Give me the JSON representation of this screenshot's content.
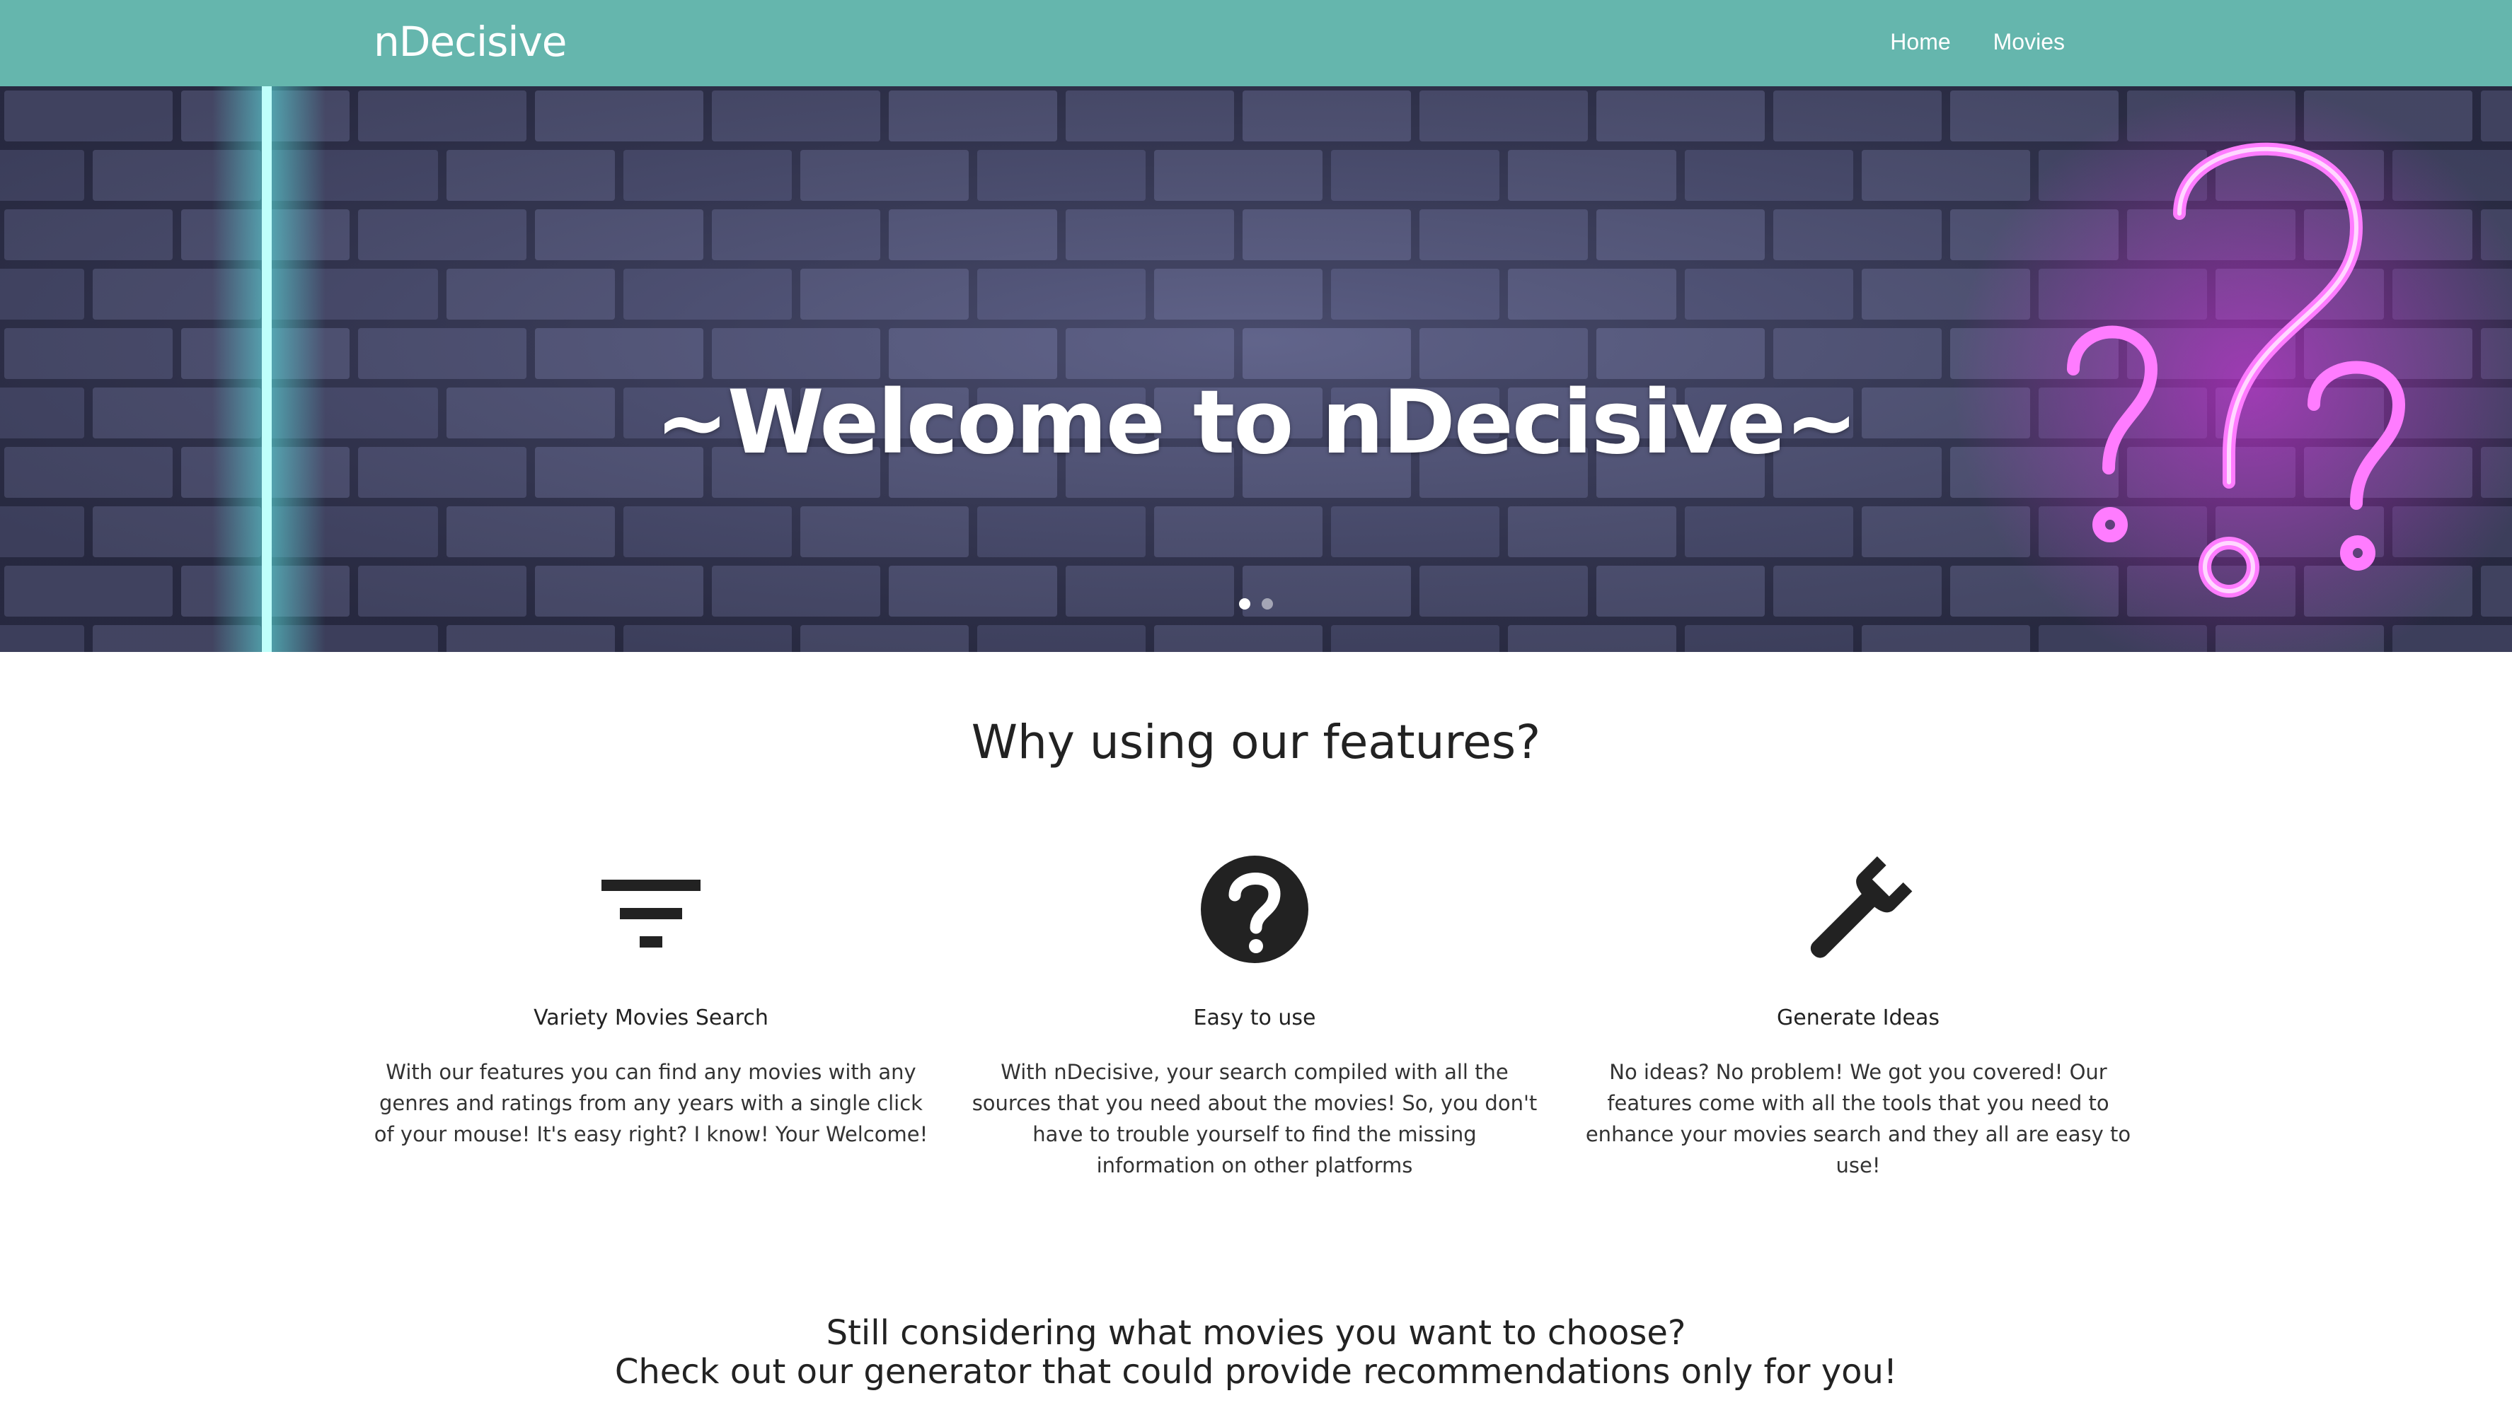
{
  "navbar": {
    "brand": "nDecisive",
    "links": [
      {
        "label": "Home"
      },
      {
        "label": "Movies"
      }
    ],
    "background": "#65b6ad"
  },
  "hero": {
    "title": "~Welcome to nDecisive~",
    "slides": 2,
    "active_slide": 1,
    "colors": {
      "wall": "#4b4d6e",
      "neon_left": "#5ff3ee",
      "neon_right": "#e62ef0"
    }
  },
  "features": {
    "heading": "Why using our features?",
    "items": [
      {
        "icon": "filter-icon",
        "title": "Variety Movies Search",
        "description": "With our features you can find any movies with any genres and ratings from any years with a single click of your mouse! It's easy right? I know! Your Welcome!"
      },
      {
        "icon": "question-circle-icon",
        "title": "Easy to use",
        "description": "With nDecisive, your search compiled with all the sources that you need about the movies! So, you don't have to trouble yourself to find the missing information on other platforms"
      },
      {
        "icon": "wrench-icon",
        "title": "Generate Ideas",
        "description": "No ideas? No problem! We got you covered! Our features come with all the tools that you need to enhance your movies search and they all are easy to use!"
      }
    ]
  },
  "cta": {
    "line1": "Still considering what movies you want to choose?",
    "line2": "Check out our generator that could provide recommendations only for you!"
  }
}
